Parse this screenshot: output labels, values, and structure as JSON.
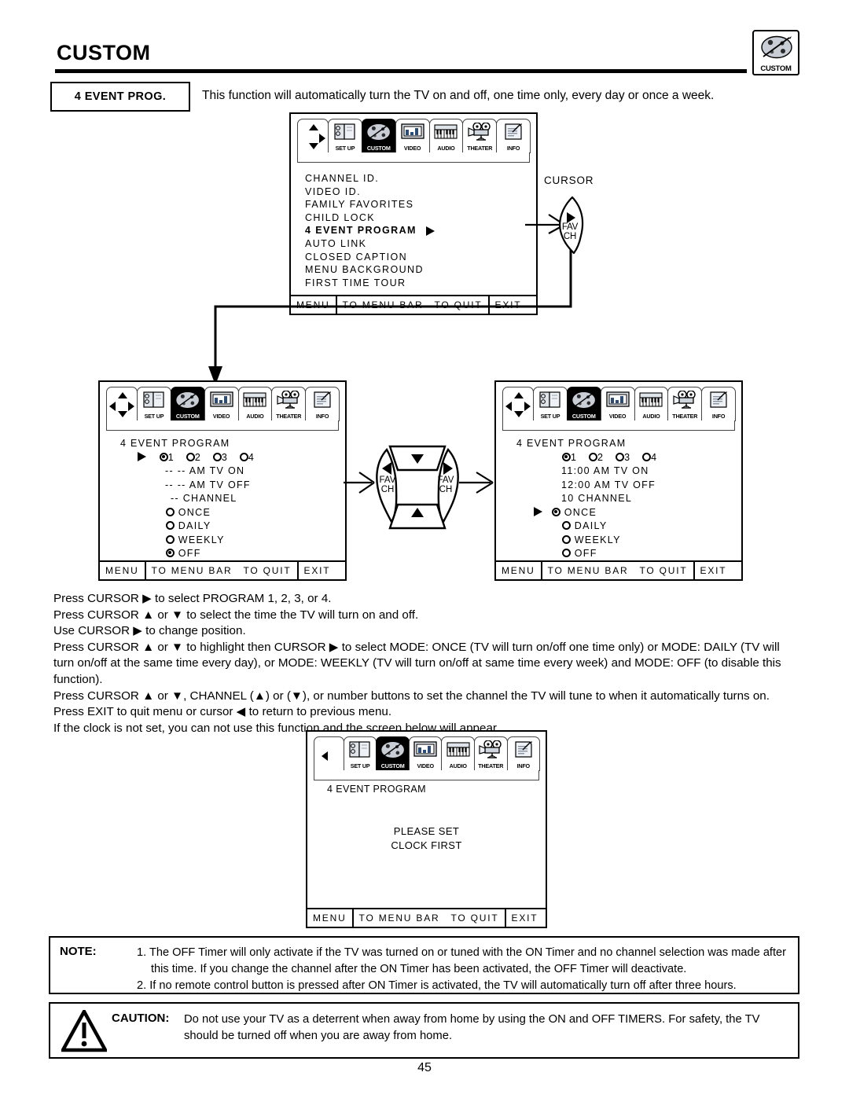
{
  "header": {
    "title": "CUSTOM",
    "corner_icon_label": "CUSTOM",
    "corner_icon_name": "palette-icon"
  },
  "section": {
    "badge": "4 EVENT PROG.",
    "intro": "This function will automatically turn the TV on and off, one time only, every day or once a week."
  },
  "menubar": {
    "tabs": [
      {
        "label": "SET UP",
        "icon": "setup-icon"
      },
      {
        "label": "CUSTOM",
        "icon": "palette-icon"
      },
      {
        "label": "VIDEO",
        "icon": "monitor-icon"
      },
      {
        "label": "AUDIO",
        "icon": "keyboard-icon"
      },
      {
        "label": "THEATER",
        "icon": "movie-camera-icon"
      },
      {
        "label": "INFO",
        "icon": "document-icon"
      }
    ],
    "active": "CUSTOM"
  },
  "footer_bar": {
    "menu": "MENU",
    "to_menu_bar": "TO MENU BAR",
    "to_quit": "TO QUIT",
    "exit": "EXIT"
  },
  "screen_custom_menu": {
    "items": [
      "CHANNEL ID.",
      "VIDEO ID.",
      "FAMILY FAVORITES",
      "CHILD LOCK",
      "4 EVENT PROGRAM",
      "AUTO LINK",
      "CLOSED CAPTION",
      "MENU BACKGROUND",
      "FIRST TIME TOUR"
    ],
    "selected": "4 EVENT PROGRAM"
  },
  "cursor_key": {
    "caption": "CURSOR",
    "fav": "FAV",
    "ch": "CH"
  },
  "screen_event_empty": {
    "heading": "4 EVENT PROGRAM",
    "programs": [
      {
        "label": "1",
        "selected": true
      },
      {
        "label": "2",
        "selected": false
      },
      {
        "label": "3",
        "selected": false
      },
      {
        "label": "4",
        "selected": false
      }
    ],
    "on_time": "-- --  AM TV ON",
    "off_time": "-- --  AM TV OFF",
    "channel": "--  CHANNEL",
    "modes": [
      {
        "label": "ONCE",
        "selected": false
      },
      {
        "label": "DAILY",
        "selected": false
      },
      {
        "label": "WEEKLY",
        "selected": false
      },
      {
        "label": "OFF",
        "selected": true
      }
    ],
    "cursor_on": "programs"
  },
  "screen_event_filled": {
    "heading": "4 EVENT PROGRAM",
    "programs": [
      {
        "label": "1",
        "selected": true
      },
      {
        "label": "2",
        "selected": false
      },
      {
        "label": "3",
        "selected": false
      },
      {
        "label": "4",
        "selected": false
      }
    ],
    "on_time": "11:00 AM TV ON",
    "off_time": "12:00 AM TV OFF",
    "channel": "10 CHANNEL",
    "modes": [
      {
        "label": "ONCE",
        "selected": true
      },
      {
        "label": "DAILY",
        "selected": false
      },
      {
        "label": "WEEKLY",
        "selected": false
      },
      {
        "label": "OFF",
        "selected": false
      }
    ],
    "cursor_on": "ONCE"
  },
  "dpad": {
    "left_fav": "FAV",
    "left_ch": "CH",
    "right_fav": "FAV",
    "right_ch": "CH"
  },
  "instructions": [
    "Press CURSOR ▶ to select PROGRAM 1, 2, 3, or 4.",
    "Press CURSOR ▲ or ▼ to select the time the TV will turn on and off.",
    "Use CURSOR ▶ to change position.",
    "Press CURSOR ▲ or ▼ to highlight then CURSOR ▶ to select MODE: ONCE (TV will turn on/off one time only) or MODE: DAILY (TV will turn on/off at the same time every day), or MODE: WEEKLY (TV will turn on/off at same time every week) and MODE: OFF (to disable this function).",
    "Press CURSOR ▲ or ▼, CHANNEL (▲) or (▼), or number buttons to set the channel the TV will tune to when it automatically turns on.",
    "Press EXIT to quit menu or cursor ◀ to return to previous menu.",
    "If the clock is not set, you can not use this function and the screen below will appear."
  ],
  "screen_clock_warning": {
    "heading": "4 EVENT PROGRAM",
    "message_line1": "PLEASE SET",
    "message_line2": "CLOCK FIRST"
  },
  "note": {
    "label": "NOTE:",
    "items": [
      "1. The OFF Timer will only activate if the TV was turned on or tuned with the ON Timer and no channel selection was made after this time.  If you change the channel after the ON Timer has been activated, the OFF Timer will deactivate.",
      "2. If no remote control button is pressed after ON Timer is activated, the TV will automatically turn off after three hours."
    ]
  },
  "caution": {
    "label": "CAUTION:",
    "text": "Do not use your TV as a deterrent when away from home by using the ON and OFF TIMERS.  For safety, the TV should be turned off when you are away from home."
  },
  "page_number": "45"
}
